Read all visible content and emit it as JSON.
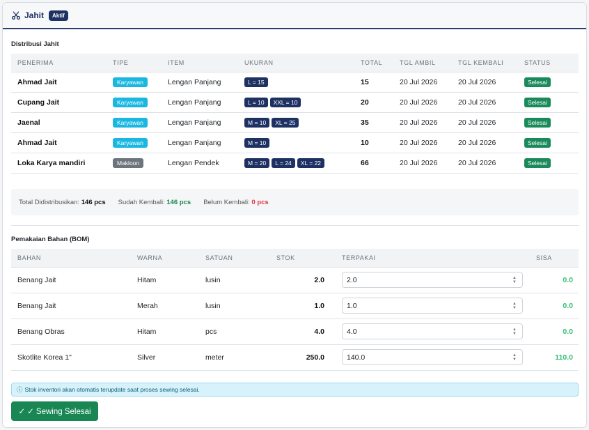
{
  "header": {
    "title": "Jahit",
    "badge": "Aktif"
  },
  "distribusi": {
    "title": "Distribusi Jahit",
    "columns": [
      "PENERIMA",
      "TIPE",
      "ITEM",
      "UKURAN",
      "TOTAL",
      "TGL AMBIL",
      "TGL KEMBALI",
      "STATUS"
    ],
    "rows": [
      {
        "penerima": "Ahmad Jait",
        "tipe": "Karyawan",
        "item": "Lengan Panjang",
        "ukuran": [
          "L = 15"
        ],
        "total": "15",
        "tgl_ambil": "20 Jul 2026",
        "tgl_kembali": "20 Jul 2026",
        "status": "Selesai"
      },
      {
        "penerima": "Cupang Jait",
        "tipe": "Karyawan",
        "item": "Lengan Panjang",
        "ukuran": [
          "L = 10",
          "XXL = 10"
        ],
        "total": "20",
        "tgl_ambil": "20 Jul 2026",
        "tgl_kembali": "20 Jul 2026",
        "status": "Selesai"
      },
      {
        "penerima": "Jaenal",
        "tipe": "Karyawan",
        "item": "Lengan Panjang",
        "ukuran": [
          "M = 10",
          "XL = 25"
        ],
        "total": "35",
        "tgl_ambil": "20 Jul 2026",
        "tgl_kembali": "20 Jul 2026",
        "status": "Selesai"
      },
      {
        "penerima": "Ahmad Jait",
        "tipe": "Karyawan",
        "item": "Lengan Panjang",
        "ukuran": [
          "M = 10"
        ],
        "total": "10",
        "tgl_ambil": "20 Jul 2026",
        "tgl_kembali": "20 Jul 2026",
        "status": "Selesai"
      },
      {
        "penerima": "Loka Karya mandiri",
        "tipe": "Makloon",
        "item": "Lengan Pendek",
        "ukuran": [
          "M = 20",
          "L = 24",
          "XL = 22"
        ],
        "total": "66",
        "tgl_ambil": "20 Jul 2026",
        "tgl_kembali": "20 Jul 2026",
        "status": "Selesai"
      }
    ]
  },
  "summary": {
    "total_label": "Total Didistribusikan:",
    "total_value": "146 pcs",
    "kembali_label": "Sudah Kembali:",
    "kembali_value": "146 pcs",
    "belum_label": "Belum Kembali:",
    "belum_value": "0 pcs"
  },
  "bom": {
    "title": "Pemakaian Bahan (BOM)",
    "columns": [
      "BAHAN",
      "WARNA",
      "SATUAN",
      "STOK",
      "TERPAKAI",
      "SISA"
    ],
    "rows": [
      {
        "bahan": "Benang Jait",
        "warna": "Hitam",
        "satuan": "lusin",
        "stok": "2.0",
        "terpakai": "2.0",
        "sisa": "0.0"
      },
      {
        "bahan": "Benang Jait",
        "warna": "Merah",
        "satuan": "lusin",
        "stok": "1.0",
        "terpakai": "1.0",
        "sisa": "0.0"
      },
      {
        "bahan": "Benang Obras",
        "warna": "Hitam",
        "satuan": "pcs",
        "stok": "4.0",
        "terpakai": "4.0",
        "sisa": "0.0"
      },
      {
        "bahan": "Skotlite Korea 1\"",
        "warna": "Silver",
        "satuan": "meter",
        "stok": "250.0",
        "terpakai": "140.0",
        "sisa": "110.0"
      }
    ]
  },
  "info": {
    "icon": "info-icon",
    "text": "Stok inventori akan otomatis terupdate saat proses sewing selesai."
  },
  "button": {
    "label": "✓ Sewing Selesai"
  },
  "colors": {
    "primary": "#1e3163",
    "success": "#198754",
    "karyawan": "#1ab8e0",
    "makloon": "#6c757d",
    "sisa": "#2fbf71",
    "danger": "#dc3545"
  }
}
